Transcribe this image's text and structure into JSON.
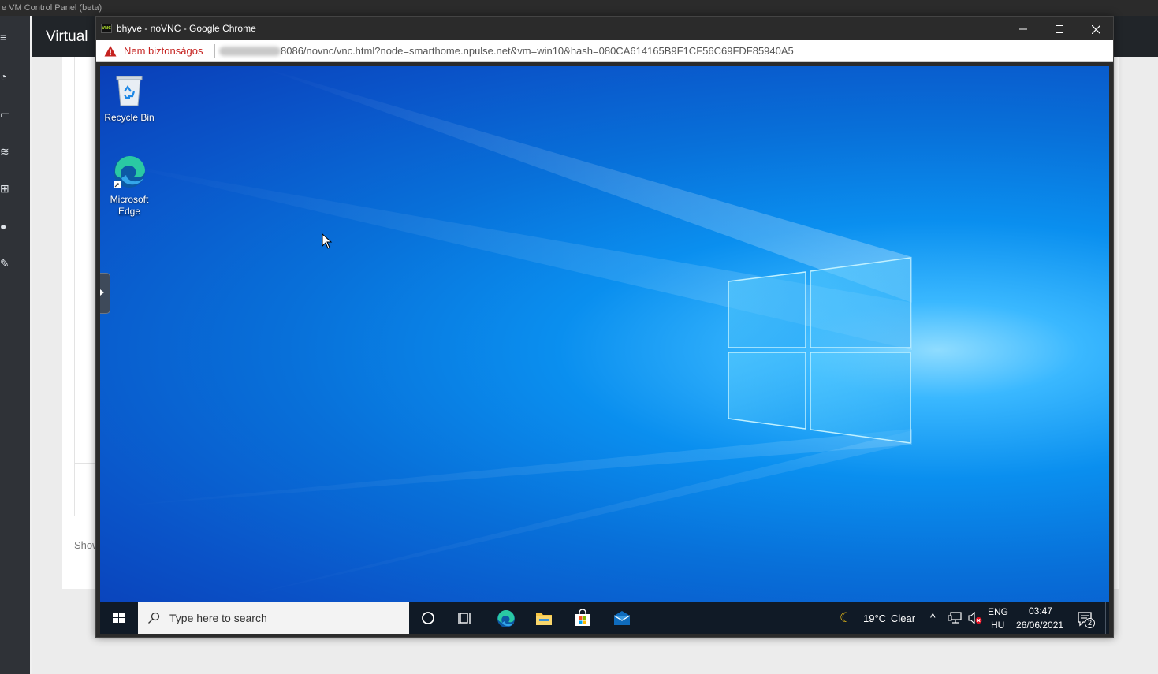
{
  "background_app": {
    "window_title": "e VM Control Panel (beta)",
    "header_title": "Virtual",
    "footer_text": "Show",
    "sidebar_icons": [
      "menu-icon",
      "dashboard-icon",
      "monitor-icon",
      "database-icon",
      "network-icon",
      "users-icon",
      "tools-icon"
    ]
  },
  "chrome": {
    "title": "bhyve - noVNC - Google Chrome",
    "favicon_text": "VNC",
    "security_label": "Nem biztonságos",
    "url_visible": "8086/novnc/vnc.html?node=smarthome.npulse.net&vm=win10&hash=080CA614165B9F1CF56C69FDF85940A5"
  },
  "desktop": {
    "icons": [
      {
        "label": "Recycle Bin",
        "icon": "recycle-bin-icon"
      },
      {
        "label": "Microsoft Edge",
        "icon": "edge-icon"
      }
    ]
  },
  "taskbar": {
    "search_placeholder": "Type here to search",
    "pinned": [
      "cortana-icon",
      "task-view-icon",
      "edge-icon",
      "file-explorer-icon",
      "store-icon",
      "mail-icon"
    ],
    "weather": {
      "temp": "19°C",
      "condition": "Clear"
    },
    "language": {
      "top": "ENG",
      "bottom": "HU"
    },
    "clock": {
      "time": "03:47",
      "date": "26/06/2021"
    },
    "notifications": "2"
  },
  "colors": {
    "insecure_red": "#c5221f",
    "desktop_blue": "#0a8fef",
    "taskbar": "#101a26"
  }
}
